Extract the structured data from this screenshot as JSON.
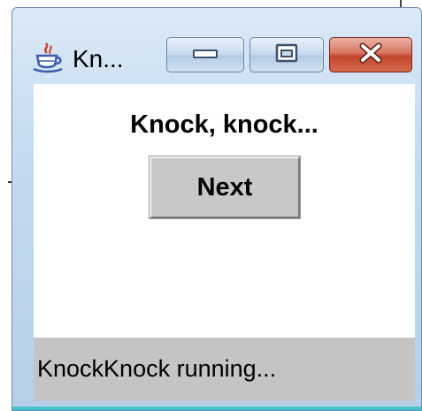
{
  "window": {
    "title": "Kn...",
    "icons": {
      "app": "java-coffee-cup-icon",
      "minimize": "minimize-icon",
      "maximize": "maximize-icon",
      "close": "close-icon"
    },
    "colors": {
      "close_button": "#c2462c",
      "titlebar": "#c3d9ef"
    }
  },
  "main": {
    "message": "Knock, knock...",
    "next_label": "Next"
  },
  "statusbar": {
    "text": "KnockKnock running..."
  }
}
